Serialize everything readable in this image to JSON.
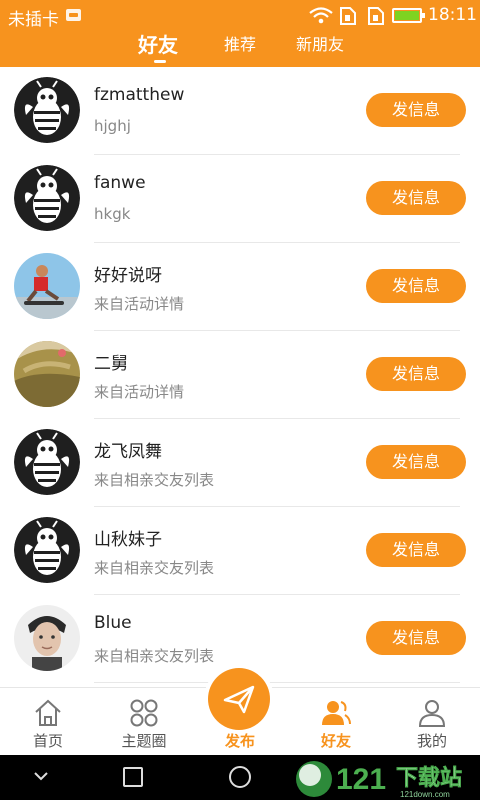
{
  "status_bar": {
    "carrier": "未插卡",
    "time": "18:11"
  },
  "top_tabs": [
    {
      "label": "好友",
      "active": true
    },
    {
      "label": "推荐",
      "active": false
    },
    {
      "label": "新朋友",
      "active": false
    }
  ],
  "friends": [
    {
      "name": "fzmatthew",
      "subtitle": "hjghj",
      "avatar": "bee-logo"
    },
    {
      "name": "fanwe",
      "subtitle": "hkgk",
      "avatar": "bee-logo"
    },
    {
      "name": "好好说呀",
      "subtitle": "来自活动详情",
      "avatar": "skateboard-photo"
    },
    {
      "name": "二舅",
      "subtitle": "来自活动详情",
      "avatar": "landscape-photo"
    },
    {
      "name": "龙飞凤舞",
      "subtitle": "来自相亲交友列表",
      "avatar": "bee-logo"
    },
    {
      "name": "山秋妹子",
      "subtitle": "来自相亲交友列表",
      "avatar": "bee-logo"
    },
    {
      "name": "Blue",
      "subtitle": "来自相亲交友列表",
      "avatar": "portrait-photo"
    }
  ],
  "message_button_label": "发信息",
  "bottom_tabs": [
    {
      "label": "首页",
      "icon": "home-icon"
    },
    {
      "label": "主题圈",
      "icon": "grid-icon"
    },
    {
      "label": "发布",
      "icon": "paper-plane-icon"
    },
    {
      "label": "好友",
      "icon": "friends-icon",
      "active": true
    },
    {
      "label": "我的",
      "icon": "profile-icon"
    }
  ],
  "watermark": {
    "text": "下载站",
    "sub": "121down.com"
  },
  "colors": {
    "accent": "#f7931e",
    "text": "#222222",
    "subtext": "#888888"
  }
}
